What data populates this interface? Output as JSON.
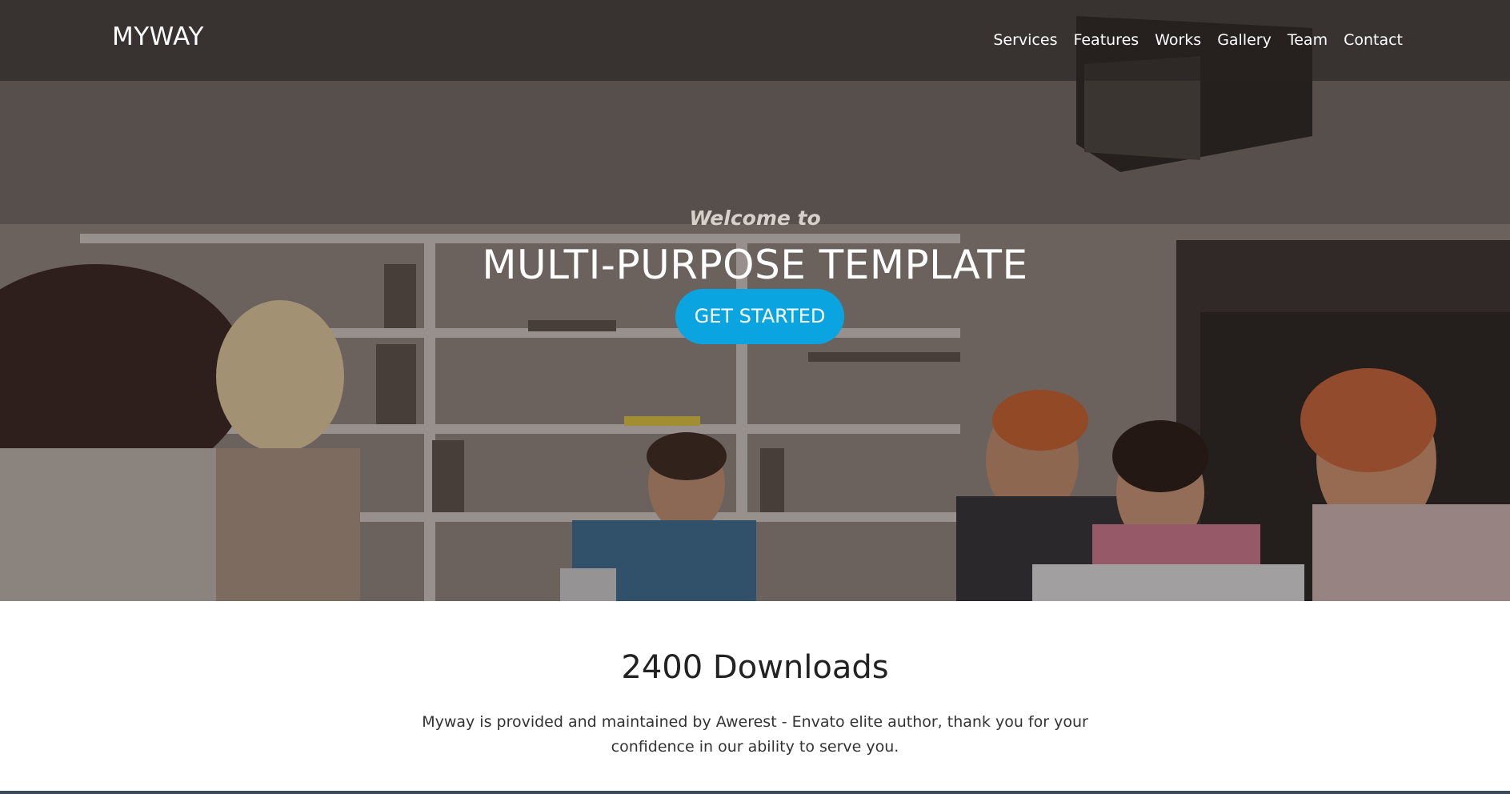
{
  "header": {
    "brand": "MYWAY",
    "nav": [
      "Services",
      "Features",
      "Works",
      "Gallery",
      "Team",
      "Contact"
    ]
  },
  "hero": {
    "welcome": "Welcome to",
    "title": "MULTI-PURPOSE TEMPLATE",
    "cta_label": "GET STARTED",
    "cta_color": "#0aa5e0"
  },
  "stats": {
    "title": "2400 Downloads",
    "description": "Myway is provided and maintained by Awerest - Envato elite author, thank you for your confidence in our ability to serve you."
  }
}
